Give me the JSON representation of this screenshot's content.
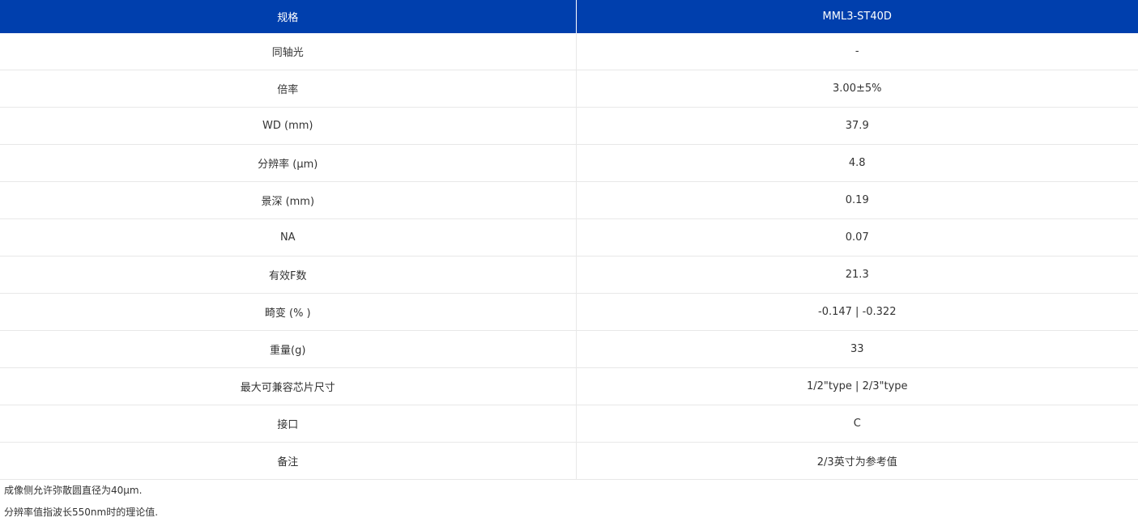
{
  "table": {
    "headers": [
      "规格",
      "MML3-ST40D"
    ],
    "rows": [
      [
        "同轴光",
        "-"
      ],
      [
        "倍率",
        "3.00±5%"
      ],
      [
        "WD (mm)",
        "37.9"
      ],
      [
        "分辨率 (μm)",
        "4.8"
      ],
      [
        "景深 (mm)",
        "0.19"
      ],
      [
        "NA",
        "0.07"
      ],
      [
        "有效F数",
        "21.3"
      ],
      [
        "畸变 (% )",
        "-0.147 | -0.322"
      ],
      [
        "重量(g)",
        "33"
      ],
      [
        "最大可兼容芯片尺寸",
        "1/2\"type | 2/3\"type"
      ],
      [
        "接口",
        "C"
      ],
      [
        "备注",
        "2/3英寸为参考值"
      ]
    ]
  },
  "notes": [
    "成像侧允许弥散圆直径为40μm.",
    "分辨率值指波长550nm时的理论值."
  ],
  "colors": {
    "header_bg": "#003fad",
    "header_text": "#ffffff",
    "row_border": "#e8e8e8"
  }
}
